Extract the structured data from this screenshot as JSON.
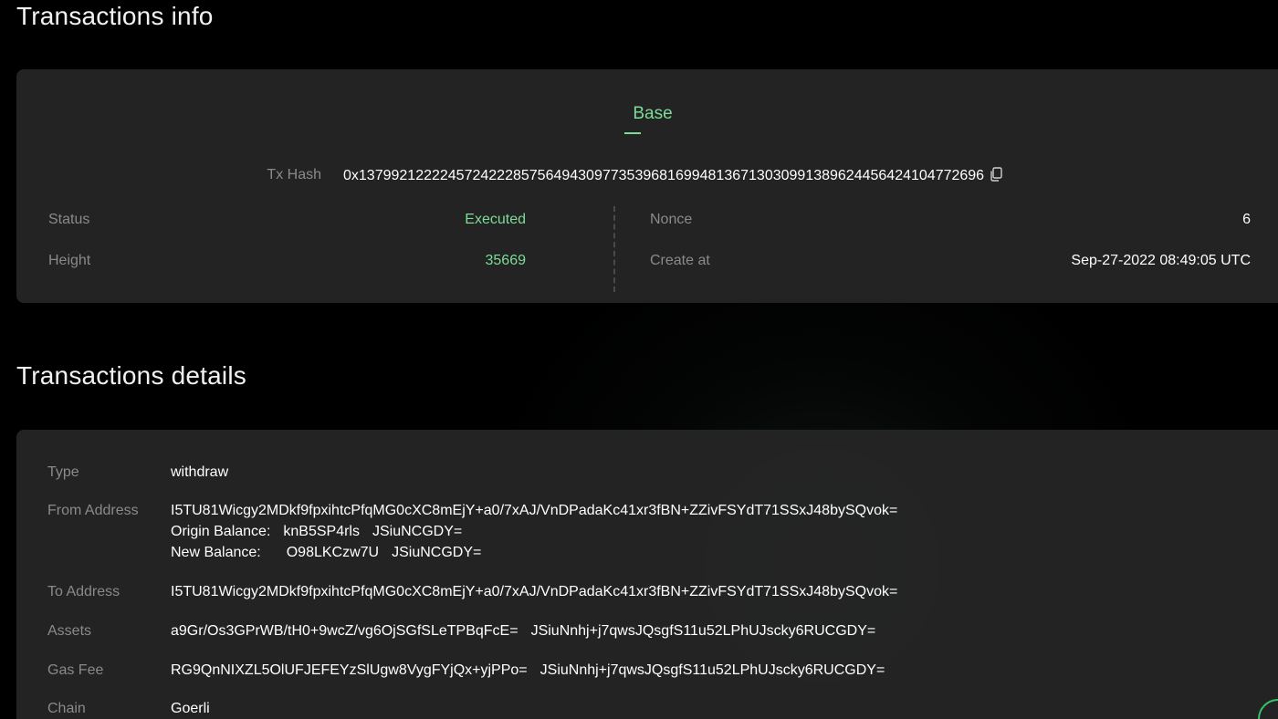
{
  "info": {
    "title": "Transactions info",
    "tab": "Base",
    "tx_hash_label": "Tx Hash",
    "tx_hash": "0x13799212222457242228575649430977353968169948136713030991389624456424104772696",
    "status_label": "Status",
    "status": "Executed",
    "height_label": "Height",
    "height": "35669",
    "nonce_label": "Nonce",
    "nonce": "6",
    "created_label": "Create at",
    "created": "Sep-27-2022 08:49:05 UTC"
  },
  "details": {
    "title": "Transactions details",
    "type_label": "Type",
    "type": "withdraw",
    "from_label": "From Address",
    "from_address": "I5TU81Wicgy2MDkf9fpxihtcPfqMG0cXC8mEjY+a0/7xAJ/VnDPadaKc41xr3fBN+ZZivFSYdT71SSxJ48bySQvok=",
    "origin_balance_label": "Origin Balance:",
    "origin_balance_amount": "knB5SP4rls",
    "origin_balance_asset": "JSiuNCGDY=",
    "new_balance_label": "New Balance:",
    "new_balance_amount": "O98LKCzw7U",
    "new_balance_asset": "JSiuNCGDY=",
    "to_label": "To Address",
    "to_address": "I5TU81Wicgy2MDkf9fpxihtcPfqMG0cXC8mEjY+a0/7xAJ/VnDPadaKc41xr3fBN+ZZivFSYdT71SSxJ48bySQvok=",
    "assets_label": "Assets",
    "assets_amount": "a9Gr/Os3GPrWB/tH0+9wcZ/vg6OjSGfSLeTPBqFcE=",
    "assets_asset": "JSiuNnhj+j7qwsJQsgfS11u52LPhUJscky6RUCGDY=",
    "gas_label": "Gas Fee",
    "gas_amount": "RG9QnNIXZL5OlUFJEFEYzSlUgw8VygFYjQx+yjPPo=",
    "gas_asset": "JSiuNnhj+j7qwsJQsgfS11u52LPhUJscky6RUCGDY=",
    "chain_label": "Chain",
    "chain": "Goerli"
  },
  "colors": {
    "accent": "#7ddc97",
    "label": "#8a8a8a",
    "card": "#262626",
    "background": "#000000"
  },
  "icons": {
    "copy": "copy-icon"
  }
}
